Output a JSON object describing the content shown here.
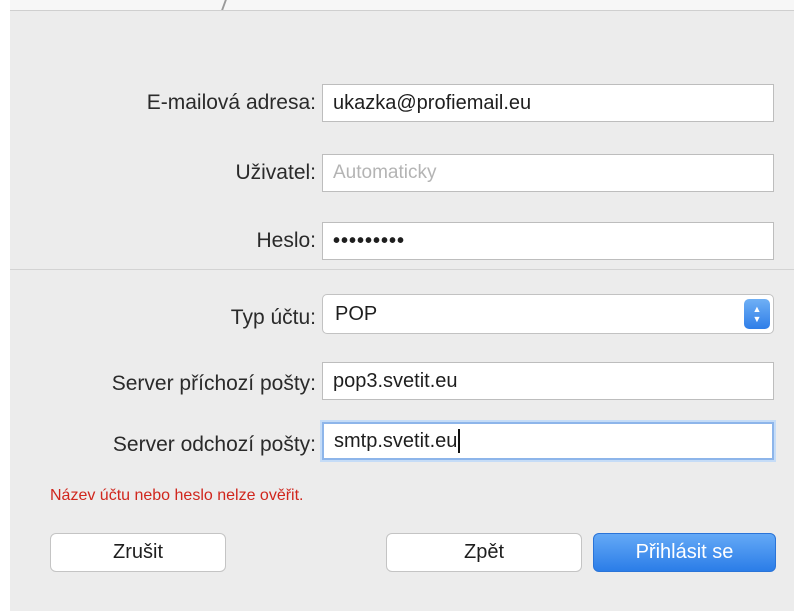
{
  "form": {
    "email": {
      "label": "E-mailová adresa:",
      "value": "ukazka@profiemail.eu"
    },
    "user": {
      "label": "Uživatel:",
      "placeholder": "Automaticky"
    },
    "password": {
      "label": "Heslo:",
      "masked": "•••••••••"
    },
    "account_type": {
      "label": "Typ účtu:",
      "selected": "POP"
    },
    "incoming": {
      "label": "Server příchozí pošty:",
      "value": "pop3.svetit.eu"
    },
    "outgoing": {
      "label": "Server odchozí pošty:",
      "value": "smtp.svetit.eu"
    }
  },
  "error_message": "Název účtu nebo heslo nelze ověřit.",
  "buttons": {
    "cancel": "Zrušit",
    "back": "Zpět",
    "sign_in": "Přihlásit se"
  },
  "colors": {
    "accent": "#2f7ee8",
    "error": "#d0261d",
    "panel": "#ececec"
  },
  "icons": {
    "popup_stepper": "chevron-up-down-icon"
  }
}
